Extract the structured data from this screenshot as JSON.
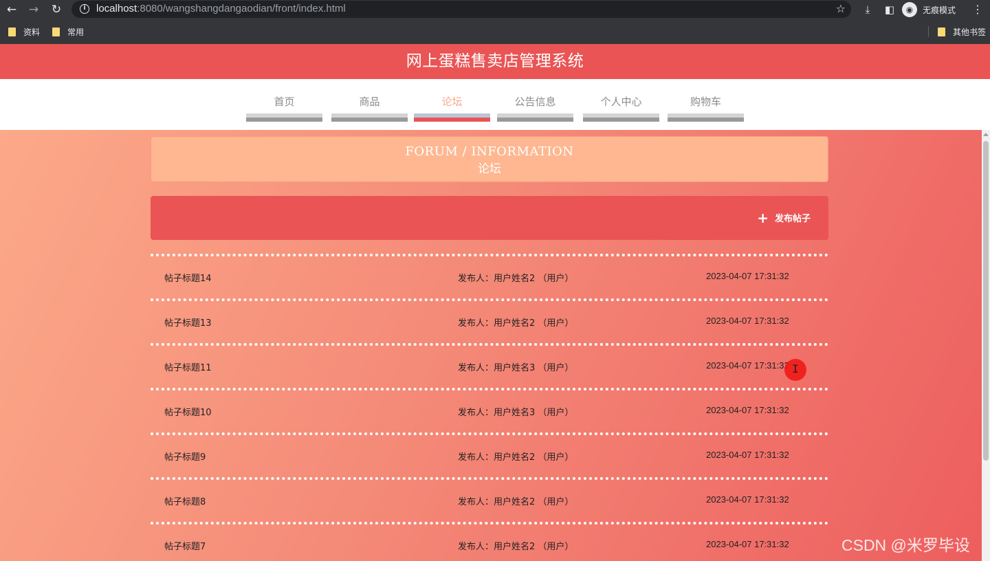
{
  "browser": {
    "url_host": "localhost",
    "url_rest": ":8080/wangshangdangaodian/front/index.html",
    "incognito_label": "无痕模式",
    "bookmarks": [
      {
        "label": "资料"
      },
      {
        "label": "常用"
      }
    ],
    "other_bookmarks_label": "其他书签"
  },
  "site": {
    "title": "网上蛋糕售卖店管理系统",
    "nav": [
      {
        "label": "首页",
        "active": false
      },
      {
        "label": "商品",
        "active": false
      },
      {
        "label": "论坛",
        "active": true
      },
      {
        "label": "公告信息",
        "active": false
      },
      {
        "label": "个人中心",
        "active": false
      },
      {
        "label": "购物车",
        "active": false
      }
    ]
  },
  "section": {
    "title_en": "FORUM / INFORMATION",
    "title_cn": "论坛",
    "publish_label": "发布帖子"
  },
  "posts": [
    {
      "title": "帖子标题14",
      "author": "发布人：用户姓名2 （用户）",
      "time": "2023-04-07 17:31:32"
    },
    {
      "title": "帖子标题13",
      "author": "发布人：用户姓名2 （用户）",
      "time": "2023-04-07 17:31:32"
    },
    {
      "title": "帖子标题11",
      "author": "发布人：用户姓名3 （用户）",
      "time": "2023-04-07 17:31:32"
    },
    {
      "title": "帖子标题10",
      "author": "发布人：用户姓名3 （用户）",
      "time": "2023-04-07 17:31:32"
    },
    {
      "title": "帖子标题9",
      "author": "发布人：用户姓名2 （用户）",
      "time": "2023-04-07 17:31:32"
    },
    {
      "title": "帖子标题8",
      "author": "发布人：用户姓名2 （用户）",
      "time": "2023-04-07 17:31:32"
    },
    {
      "title": "帖子标题7",
      "author": "发布人：用户姓名2 （用户）",
      "time": "2023-04-07 17:31:32"
    }
  ],
  "watermark": "CSDN @米罗毕设",
  "colors": {
    "header_red": "#ea5455",
    "section_peach": "#feb791",
    "active_nav": "#f7a98a"
  }
}
